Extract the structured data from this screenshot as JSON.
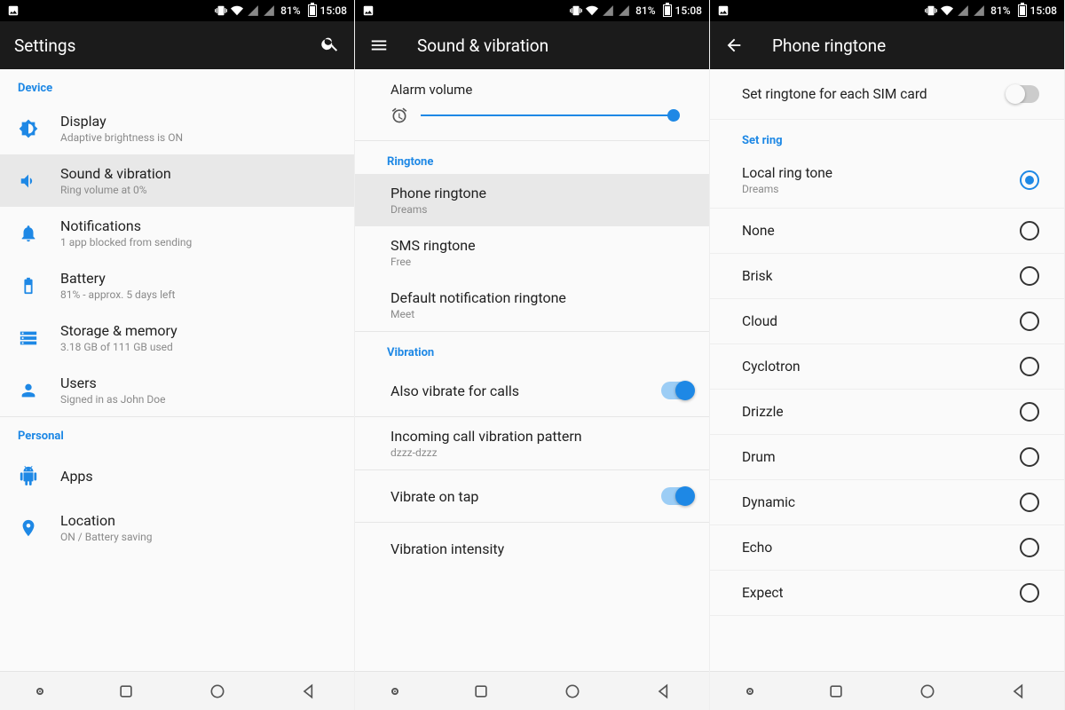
{
  "status": {
    "battery_pct": "81%",
    "time": "15:08"
  },
  "panel1": {
    "title": "Settings",
    "section_device": "Device",
    "section_personal": "Personal",
    "items": {
      "display": {
        "title": "Display",
        "sub": "Adaptive brightness is ON"
      },
      "sound": {
        "title": "Sound & vibration",
        "sub": "Ring volume at 0%"
      },
      "notif": {
        "title": "Notifications",
        "sub": "1 app blocked from sending"
      },
      "battery": {
        "title": "Battery",
        "sub": "81% - approx. 5 days left"
      },
      "storage": {
        "title": "Storage & memory",
        "sub": "3.18 GB of 111 GB used"
      },
      "users": {
        "title": "Users",
        "sub": "Signed in as John Doe"
      },
      "apps": {
        "title": "Apps"
      },
      "location": {
        "title": "Location",
        "sub": "ON / Battery saving"
      }
    }
  },
  "panel2": {
    "title": "Sound & vibration",
    "alarm_label": "Alarm volume",
    "alarm_value_pct": 100,
    "section_ringtone": "Ringtone",
    "section_vibration": "Vibration",
    "items": {
      "phone": {
        "title": "Phone ringtone",
        "sub": "Dreams"
      },
      "sms": {
        "title": "SMS ringtone",
        "sub": "Free"
      },
      "defnot": {
        "title": "Default notification ringtone",
        "sub": "Meet"
      },
      "alsovib": {
        "title": "Also vibrate for calls",
        "on": true
      },
      "pattern": {
        "title": "Incoming call vibration pattern",
        "sub": "dzzz-dzzz"
      },
      "tap": {
        "title": "Vibrate on tap",
        "on": true
      },
      "intens": {
        "title": "Vibration intensity"
      }
    }
  },
  "panel3": {
    "title": "Phone ringtone",
    "sim_label": "Set ringtone for each SIM card",
    "sim_on": false,
    "section_setring": "Set ring",
    "local_sub": "Dreams",
    "options": [
      "Local ring tone",
      "None",
      "Brisk",
      "Cloud",
      "Cyclotron",
      "Drizzle",
      "Drum",
      "Dynamic",
      "Echo",
      "Expect"
    ],
    "selected_index": 0
  }
}
